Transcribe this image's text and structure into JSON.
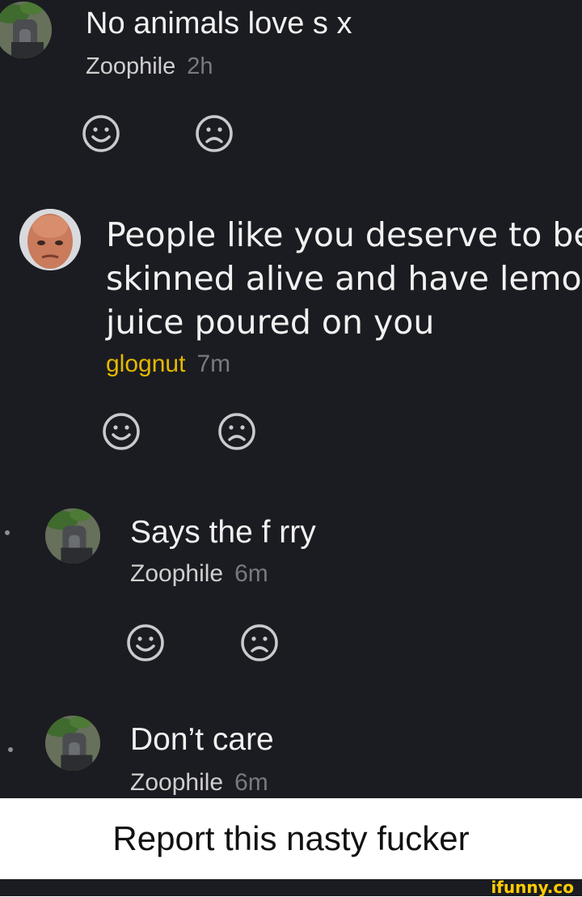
{
  "comments": [
    {
      "text": "No animals love s x",
      "author": "Zoophile",
      "time": "2h",
      "avatar": "donkey-avatar"
    },
    {
      "text_lines": [
        "People like you deserve to be",
        "skinned alive and have lemon",
        "juice poured on you"
      ],
      "author": "glognut",
      "time": "7m",
      "avatar": "bald-man-avatar"
    },
    {
      "text": "Says the f rry",
      "author": "Zoophile",
      "time": "6m",
      "avatar": "donkey-avatar"
    },
    {
      "text": "Don’t care",
      "author": "Zoophile",
      "time": "6m",
      "avatar": "donkey-avatar"
    }
  ],
  "reactions": {
    "like_icon": "smile-icon",
    "dislike_icon": "frown-icon"
  },
  "caption": "Report this nasty fucker",
  "watermark": "ifunny.co",
  "colors": {
    "background": "#1b1c21",
    "author_highlight": "#e5b800",
    "text": "#f1f1f1",
    "timestamp": "#777a80"
  }
}
